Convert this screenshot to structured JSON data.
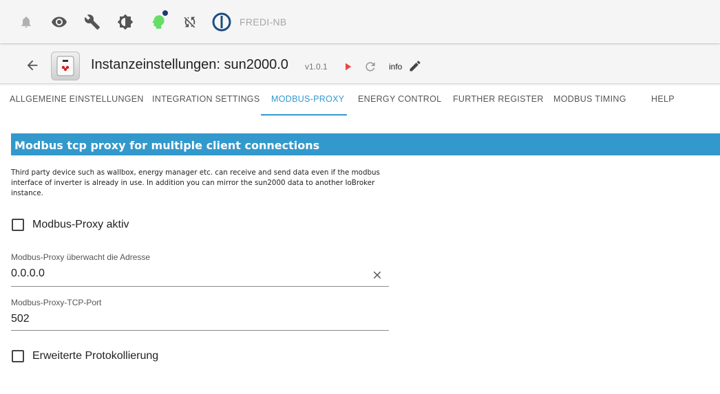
{
  "topbar": {
    "icons": [
      "bell-icon",
      "eye-icon",
      "wrench-icon",
      "brightness-icon",
      "expert-head-icon",
      "sync-off-icon",
      "iobroker-logo-icon"
    ],
    "host": "FREDI-NB",
    "colors": {
      "background": "#f5f5f5",
      "icon": "#555555",
      "bell": "#b0b0b0",
      "expert": "#66dd66",
      "badge": "#1a3a6e",
      "logo": "#1c4d80"
    }
  },
  "header": {
    "title": "Instanzeinstellungen: sun2000.0",
    "version": "v1.0.1",
    "info_label": "info",
    "colors": {
      "play": "#ee4444",
      "reload": "#9e9e9e"
    }
  },
  "tabs": [
    {
      "label": "ALLGEMEINE EINSTELLUNGEN"
    },
    {
      "label": "INTEGRATION SETTINGS"
    },
    {
      "label": "MODBUS-PROXY"
    },
    {
      "label": "ENERGY CONTROL"
    },
    {
      "label": "FURTHER REGISTER"
    },
    {
      "label": "MODBUS TIMING"
    },
    {
      "label": "HELP"
    }
  ],
  "active_tab": "MODBUS-PROXY",
  "accent_color": "#3399cc",
  "section": {
    "heading": "Modbus tcp proxy for multiple client connections",
    "description_lines": [
      "Third party device such as wallbox, energy manager etc. can receive and send data even if the modbus",
      "interface of inverter is already in use. In addition you can mirror the sun2000 data to another IoBroker",
      "instance."
    ]
  },
  "form": {
    "proxy_active": {
      "label": "Modbus-Proxy aktiv",
      "checked": false
    },
    "address": {
      "label": "Modbus-Proxy überwacht die Adresse",
      "value": "0.0.0.0"
    },
    "port": {
      "label": "Modbus-Proxy-TCP-Port",
      "value": "502"
    },
    "extended_logging": {
      "label": "Erweiterte Protokollierung",
      "checked": false
    }
  }
}
